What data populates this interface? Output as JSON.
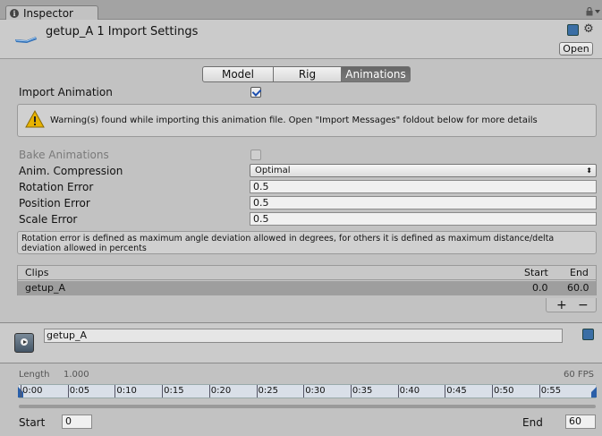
{
  "window": {
    "tab_title": "Inspector",
    "info_glyph": "i"
  },
  "header": {
    "title": "getup_A 1 Import Settings",
    "open_label": "Open",
    "gear_glyph": "⚙"
  },
  "tabs": [
    {
      "label": "Model"
    },
    {
      "label": "Rig"
    },
    {
      "label": "Animations",
      "active": true
    }
  ],
  "import_animation": {
    "label": "Import Animation",
    "checked": true
  },
  "warning": {
    "text": "Warning(s) found while importing this animation file. Open \"Import Messages\" foldout below for more details"
  },
  "bake_animations": {
    "label": "Bake Animations",
    "checked": false,
    "disabled": true
  },
  "anim_compression": {
    "label": "Anim. Compression",
    "value": "Optimal",
    "arrows": "⬍"
  },
  "rotation_error": {
    "label": "Rotation Error",
    "value": "0.5"
  },
  "position_error": {
    "label": "Position Error",
    "value": "0.5"
  },
  "scale_error": {
    "label": "Scale Error",
    "value": "0.5"
  },
  "help_text": "Rotation error is defined as maximum angle deviation allowed in degrees, for others it is defined as maximum distance/delta deviation allowed in percents",
  "clips": {
    "headers": {
      "clips": "Clips",
      "start": "Start",
      "end": "End"
    },
    "rows": [
      {
        "name": "getup_A",
        "start": "0.0",
        "end": "60.0"
      }
    ],
    "add_label": "+",
    "remove_label": "−"
  },
  "clip_panel": {
    "name": "getup_A"
  },
  "timeline": {
    "length_label": "Length",
    "length_value": "1.000",
    "fps_label": "60 FPS",
    "ticks": [
      "0:00",
      "0:05",
      "0:10",
      "0:15",
      "0:20",
      "0:25",
      "0:30",
      "0:35",
      "0:40",
      "0:45",
      "0:50",
      "0:55"
    ],
    "start_label": "Start",
    "start_value": "0",
    "end_label": "End",
    "end_value": "60"
  },
  "colors": {
    "background": "#c2c2c2",
    "accent": "#2b5fa8",
    "warning": "#e8b300"
  }
}
